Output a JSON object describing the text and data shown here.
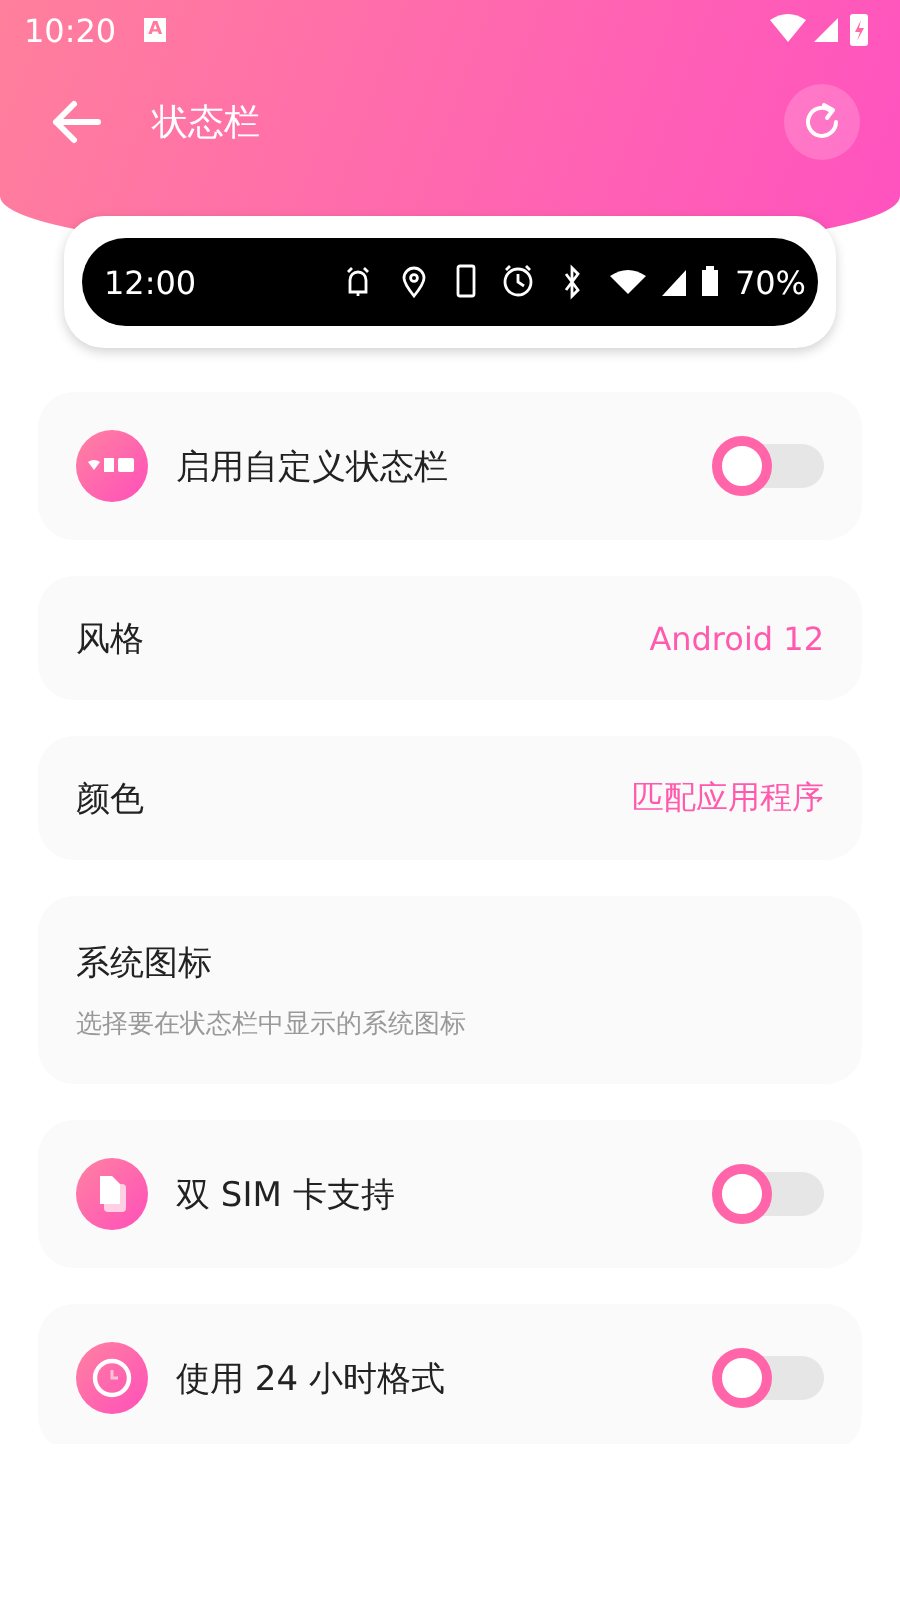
{
  "status_bar": {
    "time": "10:20",
    "notification": "A"
  },
  "header": {
    "title": "状态栏"
  },
  "preview": {
    "time": "12:00",
    "battery": "70%"
  },
  "settings": [
    {
      "kind": "toggle",
      "label": "启用自定义状态栏",
      "on": false
    },
    {
      "kind": "value",
      "label": "风格",
      "value": "Android 12"
    },
    {
      "kind": "value",
      "label": "颜色",
      "value": "匹配应用程序"
    },
    {
      "kind": "info",
      "label": "系统图标",
      "description": "选择要在状态栏中显示的系统图标"
    },
    {
      "kind": "toggle",
      "label": "双 SIM 卡支持",
      "on": false
    },
    {
      "kind": "toggle",
      "label": "使用 24 小时格式",
      "on": false
    }
  ]
}
